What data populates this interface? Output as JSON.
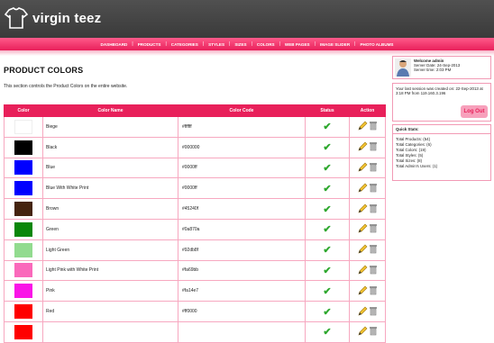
{
  "brand": {
    "name": "virgin teez"
  },
  "nav": [
    "DASHBOARD",
    "PRODUCTS",
    "CATEGORIES",
    "STYLES",
    "SIZES",
    "COLORS",
    "WEB PAGES",
    "IMAGE SLIDER",
    "PHOTO ALBUMS"
  ],
  "page": {
    "title": "PRODUCT COLORS",
    "description": "This section controls the Product Colors on the entire website."
  },
  "table": {
    "headers": [
      "Color",
      "Color Name",
      "Color Code",
      "Status",
      "Action"
    ],
    "rows": [
      {
        "name": "Biege",
        "code": "#ffffff",
        "color": "#ffffff"
      },
      {
        "name": "Black",
        "code": "#000000",
        "color": "#000000"
      },
      {
        "name": "Blue",
        "code": "#0000ff",
        "color": "#0000ff"
      },
      {
        "name": "Blue With White Print",
        "code": "#0000ff",
        "color": "#0000ff"
      },
      {
        "name": "Brown",
        "code": "#45240f",
        "color": "#45240f"
      },
      {
        "name": "Green",
        "code": "#0a870a",
        "color": "#0a870a"
      },
      {
        "name": "Light Green",
        "code": "#92db8f",
        "color": "#92db8f"
      },
      {
        "name": "Light Pink with White Print",
        "code": "#fa69bb",
        "color": "#fa69bb"
      },
      {
        "name": "Pink",
        "code": "#fa14e7",
        "color": "#fa14e7"
      },
      {
        "name": "Red",
        "code": "#ff0000",
        "color": "#ff0000"
      },
      {
        "name": "",
        "code": "",
        "color": "#ff0000"
      }
    ]
  },
  "sidebar": {
    "welcome": "Welcome admin",
    "server_date": "Server Date: 24-Sep-2013",
    "server_time": "Server time: 2:03 PM",
    "last_session": "Your last session was created on: 22-Sep-2013 at 3:18 PM from 119.160.3.196",
    "logout": "Log Out",
    "quick_stats_title": "Quick Stats:",
    "stats": [
      "Total Products: (54)",
      "Total Categories: (6)",
      "Total Colors: (19)",
      "Total Styles: (5)",
      "Total Sizes: (8)",
      "Total Admin's Users: (1)"
    ]
  },
  "colors": {
    "accent": "#e8205a",
    "header": "#404040",
    "check": "#2fa82f"
  }
}
